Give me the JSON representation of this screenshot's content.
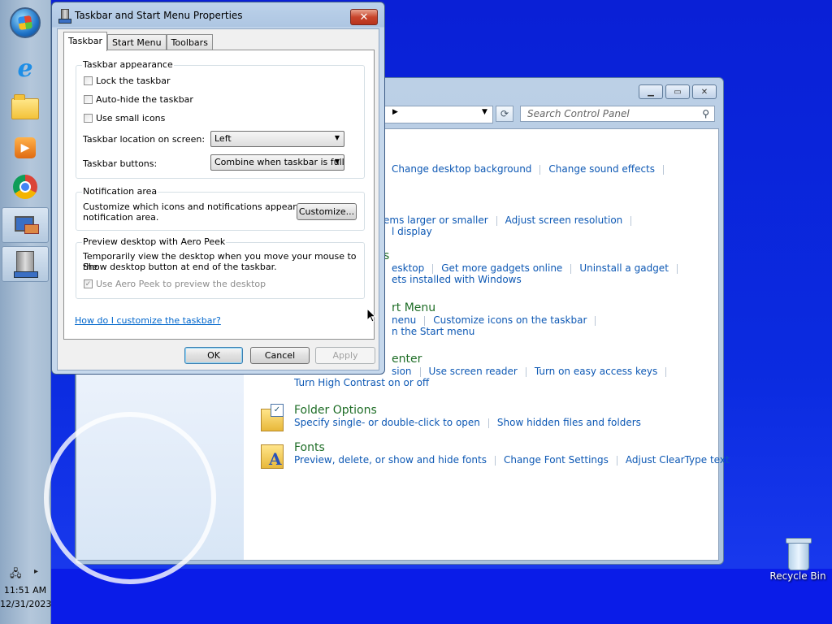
{
  "taskbar": {
    "time": "11:51 AM",
    "date": "12/31/2023",
    "apps": [
      "start-orb",
      "internet-explorer-icon",
      "file-explorer-icon",
      "media-player-icon",
      "chrome-icon",
      "control-panel-icon",
      "taskbar-properties-icon"
    ]
  },
  "desktop": {
    "recycle_bin": "Recycle Bin"
  },
  "control_panel": {
    "search_placeholder": "Search Control Panel",
    "categories": [
      {
        "title": "",
        "links": [
          "Change desktop background",
          "Change sound effects"
        ]
      },
      {
        "title": "",
        "links": [
          "ems larger or smaller",
          "Adjust screen resolution"
        ],
        "links2": [
          "l display"
        ]
      },
      {
        "title": "s",
        "links": [
          "esktop",
          "Get more gadgets online",
          "Uninstall a gadget"
        ],
        "links2": [
          "ets installed with Windows"
        ]
      },
      {
        "title": "rt Menu",
        "links": [
          "nenu",
          "Customize icons on the taskbar"
        ],
        "links2": [
          "n the Start menu"
        ]
      },
      {
        "title": "enter",
        "links": [
          "sion",
          "Use screen reader",
          "Turn on easy access keys"
        ],
        "links2": [
          "Turn High Contrast on or off"
        ]
      },
      {
        "title": "Folder Options",
        "links": [
          "Specify single- or double-click to open",
          "Show hidden files and folders"
        ]
      },
      {
        "title": "Fonts",
        "links": [
          "Preview, delete, or show and hide fonts",
          "Change Font Settings",
          "Adjust ClearType text"
        ]
      }
    ]
  },
  "dialog": {
    "title": "Taskbar and Start Menu Properties",
    "close_label": "✕",
    "tabs": [
      "Taskbar",
      "Start Menu",
      "Toolbars"
    ],
    "appearance": {
      "label": "Taskbar appearance",
      "lock": "Lock the taskbar",
      "autohide": "Auto-hide the taskbar",
      "small_icons": "Use small icons",
      "location_label": "Taskbar location on screen:",
      "location_value": "Left",
      "buttons_label": "Taskbar buttons:",
      "buttons_value": "Combine when taskbar is full"
    },
    "notification": {
      "label": "Notification area",
      "text1": "Customize which icons and notifications appear in the",
      "text2": "notification area.",
      "customize": "Customize..."
    },
    "aero": {
      "label": "Preview desktop with Aero Peek",
      "text1": "Temporarily view the desktop when you move your mouse to the",
      "text2": "Show desktop button at end of the taskbar.",
      "checkbox": "Use Aero Peek to preview the desktop"
    },
    "help_link": "How do I customize the taskbar?",
    "ok": "OK",
    "cancel": "Cancel",
    "apply": "Apply"
  }
}
